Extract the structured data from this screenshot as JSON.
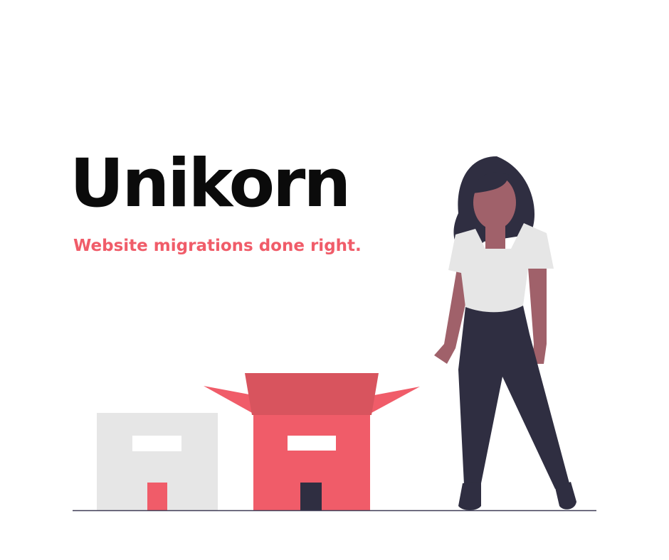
{
  "brand": {
    "name": "Unikorn",
    "tagline": "Website migrations done right."
  },
  "colors": {
    "brand_text": "#0b0b0b",
    "accent": "#f05c69",
    "accent_dark": "#d8545e",
    "light_box": "#e6e6e6",
    "dark": "#2f2e41",
    "skin": "#a0616a",
    "shirt": "#e6e6e6"
  },
  "illustration": {
    "elements": [
      "closed-grey-box",
      "open-red-box",
      "standing-woman",
      "ground-line"
    ]
  }
}
